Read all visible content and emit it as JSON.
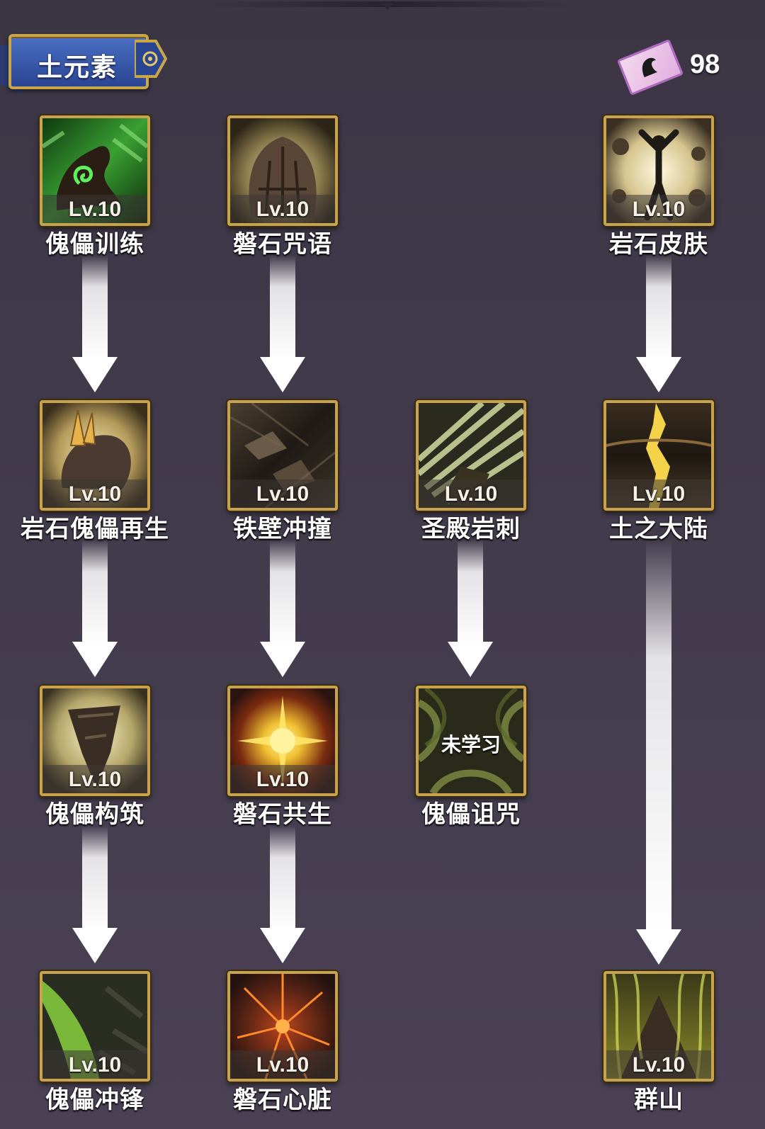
{
  "header": {
    "title": "土元素",
    "currency_icon": "skill-card-icon",
    "currency_value": "98"
  },
  "unlearned_label": "未学习",
  "skills": [
    {
      "id": "s1",
      "name": "傀儡训练",
      "level": "Lv.10",
      "learned": true,
      "icon": "swirl-green-icon"
    },
    {
      "id": "s2",
      "name": "磐石咒语",
      "level": "Lv.10",
      "learned": true,
      "icon": "rock-hand-icon"
    },
    {
      "id": "s3",
      "name": "岩石皮肤",
      "level": "Lv.10",
      "learned": true,
      "icon": "stone-figure-icon"
    },
    {
      "id": "s4",
      "name": "岩石傀儡再生",
      "level": "Lv.10",
      "learned": true,
      "icon": "rock-fist-icon"
    },
    {
      "id": "s5",
      "name": "铁壁冲撞",
      "level": "Lv.10",
      "learned": true,
      "icon": "boulder-dash-icon"
    },
    {
      "id": "s6",
      "name": "圣殿岩刺",
      "level": "Lv.10",
      "learned": true,
      "icon": "rock-spike-icon"
    },
    {
      "id": "s7",
      "name": "土之大陆",
      "level": "Lv.10",
      "learned": true,
      "icon": "earth-crack-icon"
    },
    {
      "id": "s8",
      "name": "傀儡构筑",
      "level": "Lv.10",
      "learned": true,
      "icon": "rock-shard-icon"
    },
    {
      "id": "s9",
      "name": "磐石共生",
      "level": "Lv.10",
      "learned": true,
      "icon": "sunburst-icon"
    },
    {
      "id": "s10",
      "name": "傀儡诅咒",
      "level": "",
      "learned": false,
      "icon": "curse-vortex-icon"
    },
    {
      "id": "s11",
      "name": "傀儡冲锋",
      "level": "Lv.10",
      "learned": true,
      "icon": "green-charge-icon"
    },
    {
      "id": "s12",
      "name": "磐石心脏",
      "level": "Lv.10",
      "learned": true,
      "icon": "lava-heart-icon"
    },
    {
      "id": "s13",
      "name": "群山",
      "level": "Lv.10",
      "learned": true,
      "icon": "mountain-icon"
    }
  ]
}
